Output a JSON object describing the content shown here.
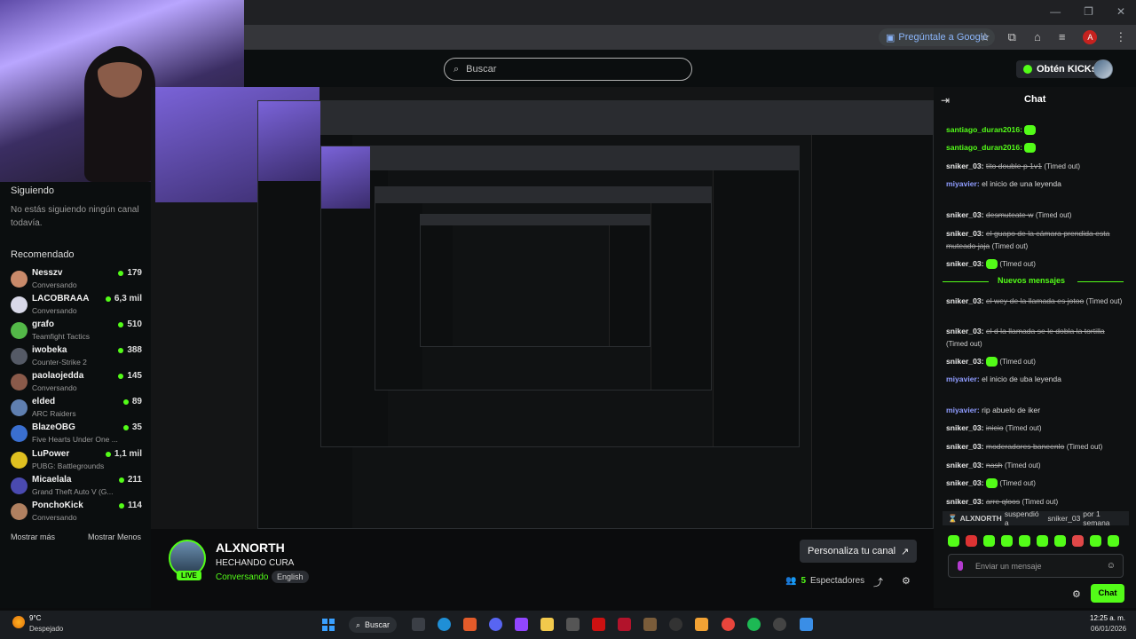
{
  "browser": {
    "ask_google": "Pregúntale a Google",
    "window_controls": [
      "—",
      "❐",
      "✕"
    ],
    "profile_initial": "A"
  },
  "header": {
    "search_placeholder": "Buscar",
    "kicks_button": "Obtén KICKs"
  },
  "sidebar": {
    "following_title": "Siguiendo",
    "following_empty": "No estás siguiendo ningún canal todavía.",
    "recommended_title": "Recomendado",
    "channels": [
      {
        "name": "Nesszv",
        "category": "Conversando",
        "viewers": "179",
        "color": "#c98a6a"
      },
      {
        "name": "LACOBRAAA",
        "category": "Conversando",
        "viewers": "6,3 mil",
        "color": "#d8d8e8"
      },
      {
        "name": "grafo",
        "category": "Teamfight Tactics",
        "viewers": "510",
        "color": "#53b848"
      },
      {
        "name": "iwobeka",
        "category": "Counter-Strike 2",
        "viewers": "388",
        "color": "#555a66"
      },
      {
        "name": "paolaojedda",
        "category": "Conversando",
        "viewers": "145",
        "color": "#8a5a4a"
      },
      {
        "name": "elded",
        "category": "ARC Raiders",
        "viewers": "89",
        "color": "#5f7fb0"
      },
      {
        "name": "BlazeOBG",
        "category": "Five Hearts Under One ...",
        "viewers": "35",
        "color": "#3a6fd0"
      },
      {
        "name": "LuPower",
        "category": "PUBG: Battlegrounds",
        "viewers": "1,1 mil",
        "color": "#e0c020"
      },
      {
        "name": "Micaelala",
        "category": "Grand Theft Auto V (G...",
        "viewers": "211",
        "color": "#4a4ab0"
      },
      {
        "name": "PonchoKick",
        "category": "Conversando",
        "viewers": "114",
        "color": "#b08060"
      }
    ],
    "show_more": "Mostrar más",
    "show_less": "Mostrar Menos"
  },
  "stream": {
    "streamer": "ALXNORTH",
    "title": "HECHANDO CURA",
    "category": "Conversando",
    "language": "English",
    "live": "LIVE",
    "customize_button": "Personaliza tu canal",
    "viewer_count": "5",
    "viewer_label": "Espectadores"
  },
  "chat": {
    "title": "Chat",
    "messages": [
      {
        "user": "santiago_duran2016:",
        "color": "#53fc18",
        "text": "",
        "strike": false,
        "timeout": ""
      },
      {
        "user": "santiago_duran2016:",
        "color": "#53fc18",
        "text": "",
        "strike": false,
        "timeout": ""
      },
      {
        "user": "sniker_03:",
        "color": "#e8e8e8",
        "text": "tito double p 1v1",
        "strike": true,
        "timeout": "(Timed out)"
      },
      {
        "user": "miyavier:",
        "color": "#8f9cff",
        "text": "el inicio de una leyenda",
        "strike": false,
        "timeout": ""
      },
      {
        "user": "sniker_03:",
        "color": "#e8e8e8",
        "text": "desmuteate w",
        "strike": true,
        "timeout": "(Timed out)"
      },
      {
        "user": "sniker_03:",
        "color": "#e8e8e8",
        "text": "el guapo de la cámara prendida esta muteado jaja",
        "strike": true,
        "timeout": "(Timed out)"
      },
      {
        "user": "sniker_03:",
        "color": "#e8e8e8",
        "text": "",
        "strike": false,
        "timeout": "(Timed out)"
      }
    ],
    "new_messages": "Nuevos mensajes",
    "messages_after": [
      {
        "user": "sniker_03:",
        "color": "#e8e8e8",
        "text": "el wey de la llamada es jotoo",
        "strike": true,
        "timeout": "(Timed out)"
      },
      {
        "user": "sniker_03:",
        "color": "#e8e8e8",
        "text": "el d la llamada se le dobla la tortilla",
        "strike": true,
        "timeout": "(Timed out)"
      },
      {
        "user": "sniker_03:",
        "color": "#e8e8e8",
        "text": "",
        "strike": false,
        "timeout": "(Timed out)"
      },
      {
        "user": "miyavier:",
        "color": "#8f9cff",
        "text": "el inicio de uba leyenda",
        "strike": false,
        "timeout": ""
      },
      {
        "user": "miyavier:",
        "color": "#8f9cff",
        "text": "rip abuelo de iker",
        "strike": false,
        "timeout": ""
      },
      {
        "user": "sniker_03:",
        "color": "#e8e8e8",
        "text": "inicio",
        "strike": true,
        "timeout": "(Timed out)"
      },
      {
        "user": "sniker_03:",
        "color": "#e8e8e8",
        "text": "moderadores baneenlo",
        "strike": true,
        "timeout": "(Timed out)"
      },
      {
        "user": "sniker_03:",
        "color": "#e8e8e8",
        "text": "nash",
        "strike": true,
        "timeout": "(Timed out)"
      },
      {
        "user": "sniker_03:",
        "color": "#e8e8e8",
        "text": "",
        "strike": false,
        "timeout": "(Timed out)"
      },
      {
        "user": "sniker_03:",
        "color": "#e8e8e8",
        "text": "arre qloos",
        "strike": true,
        "timeout": "(Timed out)"
      }
    ],
    "timeout_notice": {
      "mod": "ALXNORTH",
      "action": "suspendió a",
      "target": "sniker_03",
      "duration": "por 1 semana"
    },
    "input_placeholder": "Enviar un mensaje",
    "send_button": "Chat"
  },
  "taskbar": {
    "temperature": "9°C",
    "weather": "Despejado",
    "search": "Buscar",
    "time": "12:25 a. m.",
    "date": "06/01/2026"
  },
  "colors": {
    "accent": "#53fc18",
    "background": "#0b0e0f"
  }
}
